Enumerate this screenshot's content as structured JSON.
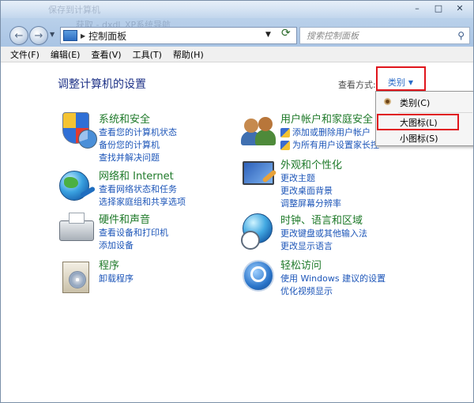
{
  "window": {
    "ghost_title": "保存到计算机",
    "ghost_sub": "获取 - dxdl_XP系统导航",
    "buttons": [
      "–",
      "□",
      "✕"
    ]
  },
  "address_bar": {
    "path": "控制面板",
    "separator": "▶"
  },
  "search": {
    "placeholder": "搜索控制面板"
  },
  "menu": [
    "文件(F)",
    "编辑(E)",
    "查看(V)",
    "工具(T)",
    "帮助(H)"
  ],
  "page": {
    "title": "调整计算机的设置",
    "view_by_label": "查看方式:",
    "view_by_value": "类别"
  },
  "categories": [
    {
      "title": "系统和安全",
      "links": [
        "查看您的计算机状态",
        "备份您的计算机",
        "查找并解决问题"
      ]
    },
    {
      "title": "网络和 Internet",
      "links": [
        "查看网络状态和任务",
        "选择家庭组和共享选项"
      ]
    },
    {
      "title": "硬件和声音",
      "links": [
        "查看设备和打印机",
        "添加设备"
      ]
    },
    {
      "title": "程序",
      "links": [
        "卸载程序"
      ]
    },
    {
      "title": "用户帐户和家庭安全",
      "links": [
        "添加或删除用户帐户",
        "为所有用户设置家长控"
      ]
    },
    {
      "title": "外观和个性化",
      "links": [
        "更改主题",
        "更改桌面背景",
        "调整屏幕分辨率"
      ]
    },
    {
      "title": "时钟、语言和区域",
      "links": [
        "更改键盘或其他输入法",
        "更改显示语言"
      ]
    },
    {
      "title": "轻松访问",
      "links": [
        "使用 Windows 建议的设置",
        "优化视频显示"
      ]
    }
  ],
  "dropdown": {
    "items": [
      "类别(C)",
      "大图标(L)",
      "小图标(S)"
    ],
    "selected": "类别(C)"
  },
  "colors": {
    "category_title": "#1f7a2a",
    "link": "#1c55b8",
    "page_title": "#1e3287",
    "highlight_box": "#e0151c"
  }
}
